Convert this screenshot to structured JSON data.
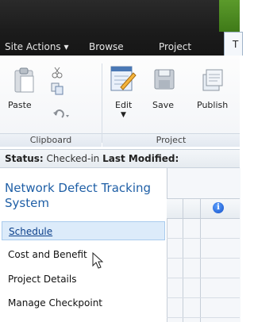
{
  "tabs": {
    "site_actions": "Site Actions ▾",
    "browse": "Browse",
    "project": "Project",
    "active_partial": "T"
  },
  "ribbon": {
    "paste_label": "Paste",
    "edit_label": "Edit",
    "save_label": "Save",
    "publish_label": "Publish",
    "clipboard_group": "Clipboard",
    "project_group": "Project"
  },
  "status": {
    "status_label": "Status:",
    "status_value": "Checked-in",
    "modified_label": "Last Modified:"
  },
  "nav": {
    "title": "Network Defect Tracking System",
    "items": [
      "Schedule",
      "Cost and Benefit",
      "Project Details",
      "Manage Checkpoint"
    ]
  },
  "grid": {
    "info_icon": "i"
  }
}
